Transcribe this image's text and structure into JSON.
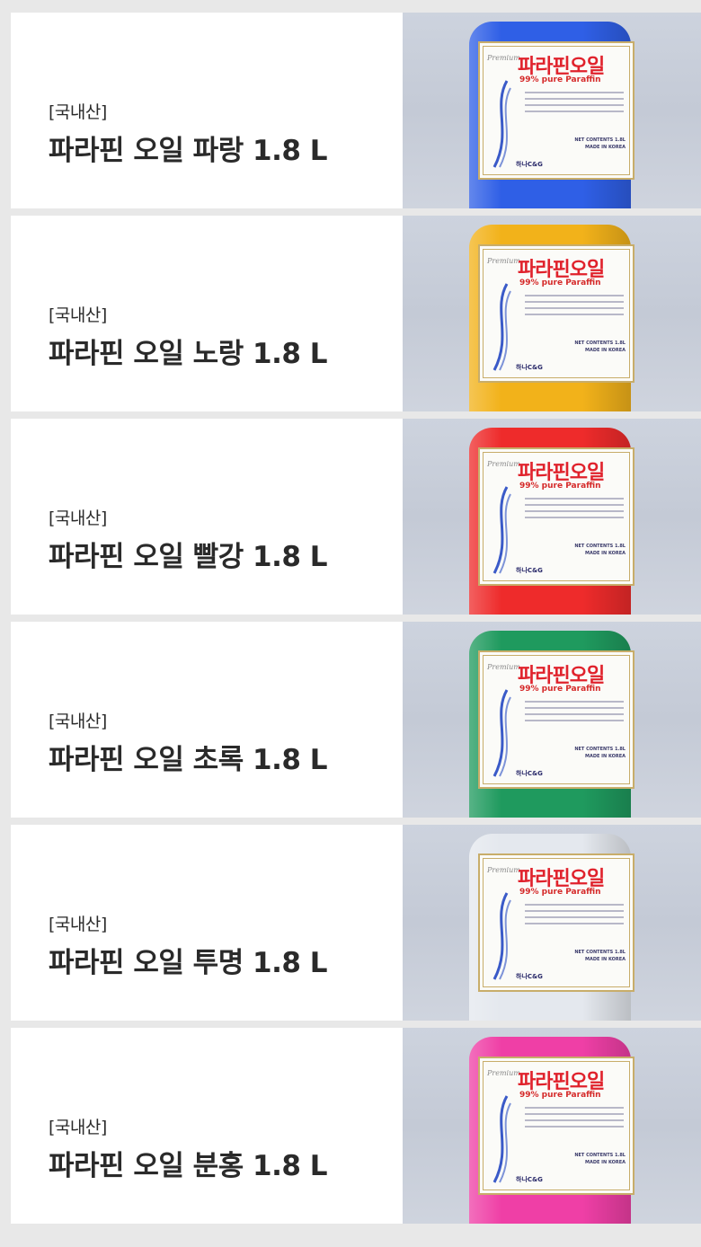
{
  "products": [
    {
      "origin": "[국내산]",
      "name": "파라핀 오일 파랑 1.8 L",
      "color": "#2f5fe6"
    },
    {
      "origin": "[국내산]",
      "name": "파라핀 오일 노랑 1.8 L",
      "color": "#f2b21a"
    },
    {
      "origin": "[국내산]",
      "name": "파라핀 오일 빨강 1.8 L",
      "color": "#ee2b2b"
    },
    {
      "origin": "[국내산]",
      "name": "파라핀 오일 초록 1.8 L",
      "color": "#1f9a5e"
    },
    {
      "origin": "[국내산]",
      "name": "파라핀 오일 투명 1.8 L",
      "color": "#e4e8ee"
    },
    {
      "origin": "[국내산]",
      "name": "파라핀 오일 분홍 1.8 L",
      "color": "#ef3fa6"
    }
  ],
  "label": {
    "premium": "Premium",
    "title": "파라핀오일",
    "subtitle": "99% pure Paraffin",
    "net_contents": "NET CONTENTS 1.8L",
    "made_in": "MADE IN KOREA",
    "brand": "하나C&G"
  }
}
